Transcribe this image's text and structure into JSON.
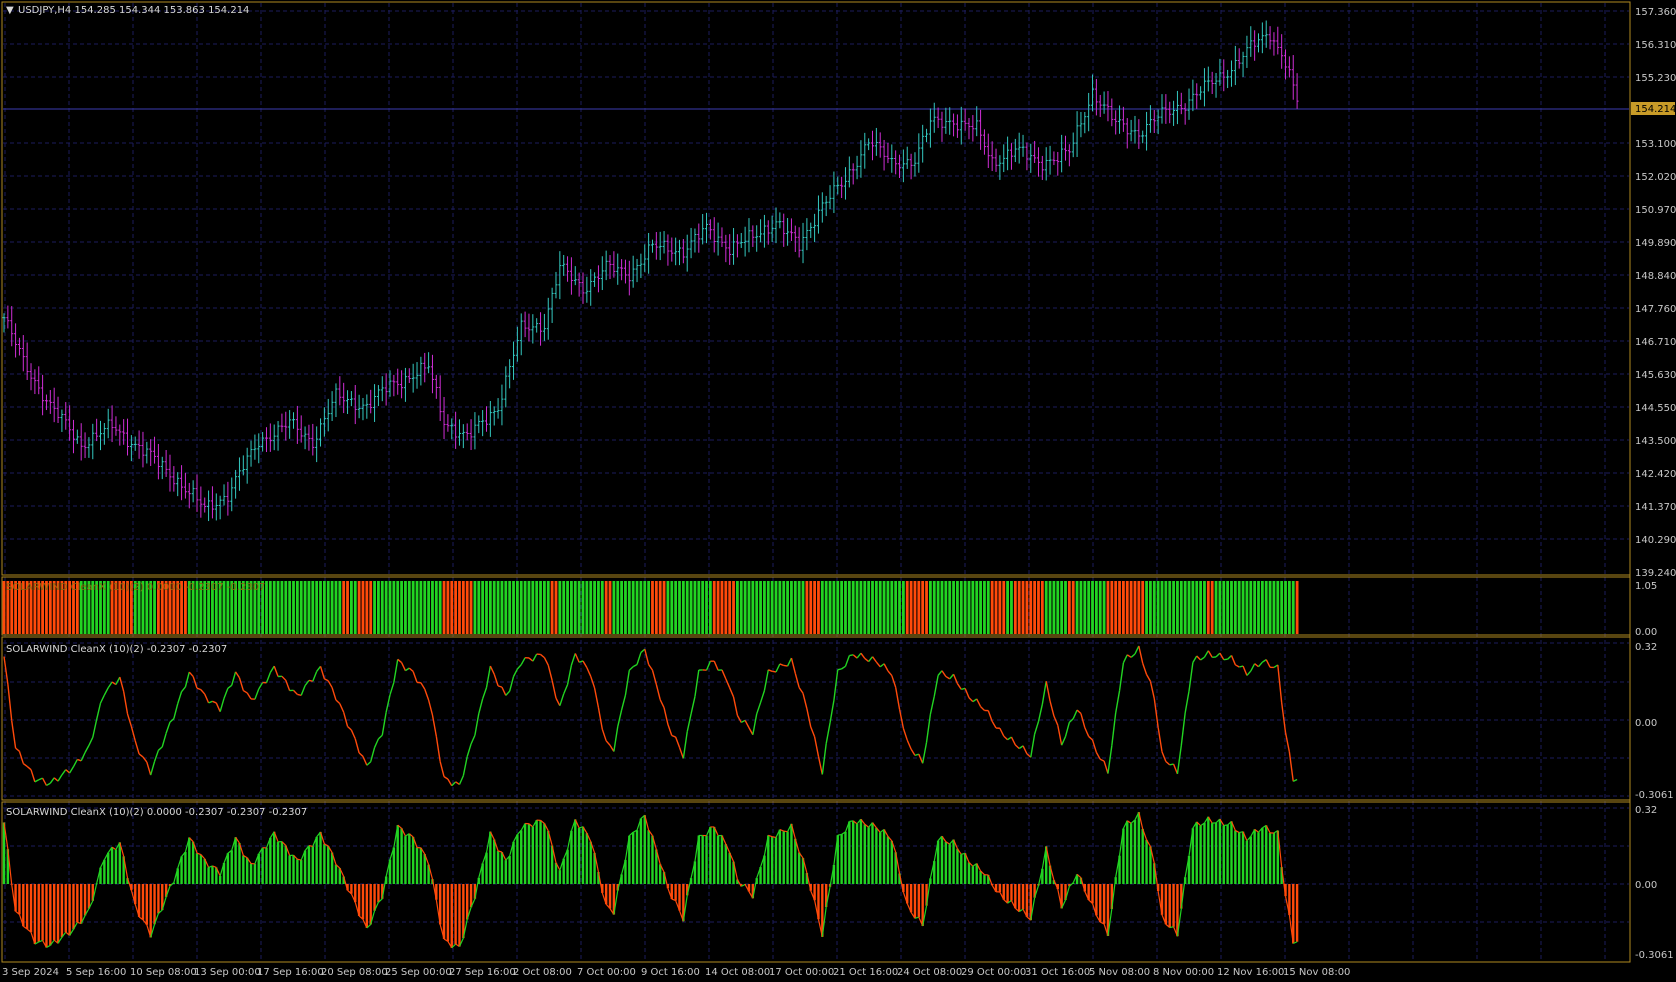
{
  "colors": {
    "background": "#000000",
    "frame": "#b08a20",
    "grid": "#1c1c5c",
    "bull": "#34c9c0",
    "bear": "#d02ed6",
    "green": "#22d422",
    "orange": "#ff4a0a",
    "price_line": "#3b3bb0",
    "price_tag_bg": "#c89b28",
    "text": "#c8c8c8"
  },
  "main": {
    "title": "USDJPY,H4  154.285 154.344 153.863 154.214",
    "current_price_label": "154.214",
    "price_axis_labels": [
      "157.360",
      "156.310",
      "155.230",
      "154.214",
      "153.100",
      "152.020",
      "150.970",
      "149.890",
      "148.840",
      "147.760",
      "146.710",
      "145.630",
      "144.550",
      "143.500",
      "142.420",
      "141.370",
      "140.290",
      "139.240"
    ]
  },
  "panel1": {
    "title": "SOLARWIND CleanX (10)(2) 0.0000 -0.2307 -0.2307",
    "axis_labels": [
      "1.05",
      "0.00"
    ]
  },
  "panel2": {
    "title": "SOLARWIND CleanX (10)(2) -0.2307 -0.2307",
    "axis_labels": [
      "0.32",
      "0.00",
      "-0.3061"
    ]
  },
  "panel3": {
    "title": "SOLARWIND CleanX (10)(2) 0.0000 -0.2307 -0.2307 -0.2307",
    "axis_labels": [
      "0.32",
      "0.00",
      "-0.3061"
    ]
  },
  "time_axis_labels": [
    "3 Sep 2024",
    "5 Sep 16:00",
    "10 Sep 08:00",
    "13 Sep 00:00",
    "17 Sep 16:00",
    "20 Sep 08:00",
    "25 Sep 00:00",
    "27 Sep 16:00",
    "2 Oct 08:00",
    "7 Oct 00:00",
    "9 Oct 16:00",
    "14 Oct 08:00",
    "17 Oct 00:00",
    "21 Oct 16:00",
    "24 Oct 08:00",
    "29 Oct 00:00",
    "31 Oct 16:00",
    "5 Nov 08:00",
    "8 Nov 00:00",
    "12 Nov 16:00",
    "15 Nov 08:00"
  ],
  "chart_data": {
    "type": "bar",
    "symbol": "USDJPY",
    "timeframe": "H4",
    "ylim": [
      139.24,
      157.36
    ],
    "price_anchors": [
      [
        0,
        146.9
      ],
      [
        5,
        145.4
      ],
      [
        12,
        143.9
      ],
      [
        20,
        142.6
      ],
      [
        28,
        143.2
      ],
      [
        36,
        142.4
      ],
      [
        44,
        141.5
      ],
      [
        52,
        140.4
      ],
      [
        58,
        140.9
      ],
      [
        66,
        142.7
      ],
      [
        74,
        143.3
      ],
      [
        80,
        142.7
      ],
      [
        86,
        144.2
      ],
      [
        94,
        143.9
      ],
      [
        100,
        144.6
      ],
      [
        110,
        145.2
      ],
      [
        114,
        143.4
      ],
      [
        120,
        142.8
      ],
      [
        128,
        143.9
      ],
      [
        134,
        146.5
      ],
      [
        140,
        146.7
      ],
      [
        144,
        148.6
      ],
      [
        150,
        147.9
      ],
      [
        156,
        148.6
      ],
      [
        162,
        148.4
      ],
      [
        168,
        149.3
      ],
      [
        176,
        149.2
      ],
      [
        182,
        149.9
      ],
      [
        188,
        149.3
      ],
      [
        194,
        149.6
      ],
      [
        200,
        150.2
      ],
      [
        206,
        149.3
      ],
      [
        212,
        150.8
      ],
      [
        218,
        151.5
      ],
      [
        224,
        153.0
      ],
      [
        230,
        152.1
      ],
      [
        236,
        152.3
      ],
      [
        240,
        153.5
      ],
      [
        246,
        153.6
      ],
      [
        252,
        153.3
      ],
      [
        256,
        152.2
      ],
      [
        262,
        152.6
      ],
      [
        268,
        152.2
      ],
      [
        272,
        152.3
      ],
      [
        276,
        152.5
      ],
      [
        282,
        154.6
      ],
      [
        288,
        153.5
      ],
      [
        294,
        153.2
      ],
      [
        300,
        153.8
      ],
      [
        306,
        154.2
      ],
      [
        312,
        154.8
      ],
      [
        318,
        155.4
      ],
      [
        324,
        156.2
      ],
      [
        328,
        156.6
      ],
      [
        332,
        155.6
      ],
      [
        335,
        154.2
      ]
    ],
    "indicator_sign_runs": [
      [
        0,
        "d"
      ],
      [
        20,
        "u"
      ],
      [
        28,
        "d"
      ],
      [
        34,
        "u"
      ],
      [
        40,
        "d"
      ],
      [
        48,
        "u"
      ],
      [
        88,
        "d"
      ],
      [
        90,
        "u"
      ],
      [
        92,
        "d"
      ],
      [
        96,
        "u"
      ],
      [
        114,
        "d"
      ],
      [
        122,
        "u"
      ],
      [
        142,
        "d"
      ],
      [
        144,
        "u"
      ],
      [
        156,
        "d"
      ],
      [
        158,
        "u"
      ],
      [
        168,
        "d"
      ],
      [
        172,
        "u"
      ],
      [
        184,
        "d"
      ],
      [
        190,
        "u"
      ],
      [
        208,
        "d"
      ],
      [
        212,
        "u"
      ],
      [
        234,
        "d"
      ],
      [
        240,
        "u"
      ],
      [
        256,
        "d"
      ],
      [
        260,
        "u"
      ],
      [
        262,
        "d"
      ],
      [
        270,
        "u"
      ],
      [
        276,
        "d"
      ],
      [
        278,
        "u"
      ],
      [
        286,
        "d"
      ],
      [
        296,
        "u"
      ],
      [
        312,
        "d"
      ],
      [
        314,
        "u"
      ],
      [
        335,
        "d"
      ]
    ],
    "oscillator_anchors": [
      [
        0,
        0.27
      ],
      [
        3,
        -0.12
      ],
      [
        8,
        -0.25
      ],
      [
        12,
        -0.27
      ],
      [
        18,
        -0.2
      ],
      [
        22,
        -0.12
      ],
      [
        26,
        0.12
      ],
      [
        30,
        0.18
      ],
      [
        34,
        -0.1
      ],
      [
        38,
        -0.22
      ],
      [
        44,
        0.02
      ],
      [
        48,
        0.2
      ],
      [
        52,
        0.1
      ],
      [
        56,
        0.05
      ],
      [
        60,
        0.2
      ],
      [
        64,
        0.08
      ],
      [
        70,
        0.22
      ],
      [
        76,
        0.1
      ],
      [
        82,
        0.22
      ],
      [
        86,
        0.1
      ],
      [
        90,
        -0.05
      ],
      [
        94,
        -0.2
      ],
      [
        98,
        -0.05
      ],
      [
        102,
        0.25
      ],
      [
        106,
        0.2
      ],
      [
        110,
        0.1
      ],
      [
        114,
        -0.25
      ],
      [
        118,
        -0.28
      ],
      [
        122,
        -0.05
      ],
      [
        126,
        0.22
      ],
      [
        130,
        0.1
      ],
      [
        134,
        0.25
      ],
      [
        140,
        0.28
      ],
      [
        144,
        0.05
      ],
      [
        148,
        0.28
      ],
      [
        152,
        0.2
      ],
      [
        156,
        -0.1
      ],
      [
        158,
        -0.12
      ],
      [
        162,
        0.2
      ],
      [
        166,
        0.3
      ],
      [
        170,
        0.1
      ],
      [
        172,
        -0.02
      ],
      [
        176,
        -0.15
      ],
      [
        180,
        0.2
      ],
      [
        184,
        0.25
      ],
      [
        188,
        0.15
      ],
      [
        190,
        0.02
      ],
      [
        194,
        -0.05
      ],
      [
        198,
        0.2
      ],
      [
        204,
        0.25
      ],
      [
        208,
        0.05
      ],
      [
        212,
        -0.22
      ],
      [
        216,
        0.2
      ],
      [
        220,
        0.28
      ],
      [
        226,
        0.25
      ],
      [
        230,
        0.2
      ],
      [
        234,
        -0.1
      ],
      [
        238,
        -0.18
      ],
      [
        242,
        0.2
      ],
      [
        246,
        0.18
      ],
      [
        250,
        0.1
      ],
      [
        254,
        0.05
      ],
      [
        258,
        -0.05
      ],
      [
        262,
        -0.1
      ],
      [
        266,
        -0.15
      ],
      [
        270,
        0.15
      ],
      [
        274,
        -0.1
      ],
      [
        278,
        0.05
      ],
      [
        282,
        -0.1
      ],
      [
        286,
        -0.22
      ],
      [
        290,
        0.25
      ],
      [
        294,
        0.3
      ],
      [
        298,
        0.1
      ],
      [
        300,
        -0.15
      ],
      [
        304,
        -0.22
      ],
      [
        308,
        0.25
      ],
      [
        312,
        0.28
      ],
      [
        318,
        0.26
      ],
      [
        322,
        0.2
      ],
      [
        326,
        0.25
      ],
      [
        330,
        0.22
      ],
      [
        332,
        -0.05
      ],
      [
        334,
        -0.25
      ]
    ]
  }
}
